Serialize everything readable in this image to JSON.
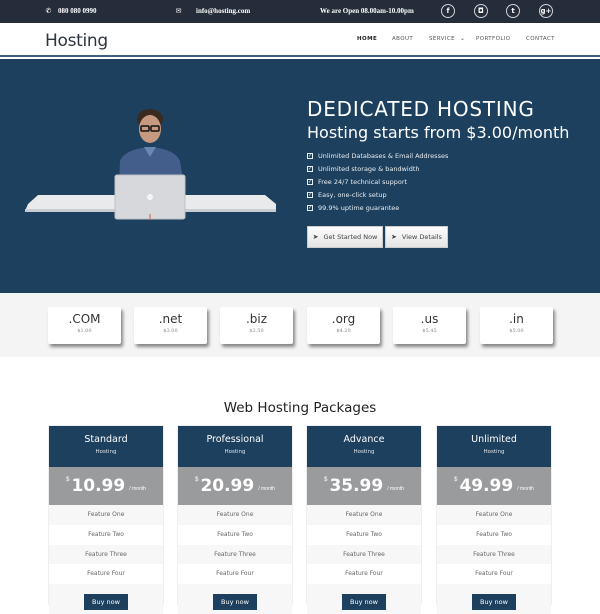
{
  "topbar": {
    "phone_icon": "phone-icon",
    "phone": "080 080 0990",
    "email_icon": "envelope-icon",
    "email": "info@hosting.com",
    "hours": "We are Open 08.00am-10.00pm",
    "social": [
      {
        "icon": "facebook-icon",
        "glyph": "f"
      },
      {
        "icon": "instagram-icon",
        "glyph": "◘"
      },
      {
        "icon": "twitter-icon",
        "glyph": "t"
      },
      {
        "icon": "google-plus-icon",
        "glyph": "g+"
      }
    ]
  },
  "nav": {
    "logo": "Hosting",
    "items": [
      "HOME",
      "ABOUT",
      "SERVICE",
      "PORTFOLIO",
      "CONTACT"
    ],
    "active": "HOME",
    "service_dropdown_icon": "chevron-down-icon"
  },
  "hero": {
    "title": "DEDICATED HOSTING",
    "subtitle": "Hosting starts from $3.00/month",
    "features": [
      "Unlimited Databases & Email Addresses",
      "Unlimited storage & bandwidth",
      "Free 24/7 technical support",
      "Easy, one-click setup",
      "99.9% uptime guarantee"
    ],
    "buttons": [
      {
        "label": "Get Started Now",
        "icon": "paper-plane-icon"
      },
      {
        "label": "View Details",
        "icon": "paper-plane-icon"
      }
    ],
    "colors": {
      "background": "#1d405e"
    }
  },
  "domains": [
    {
      "ext": ".COM",
      "price": "$1.00"
    },
    {
      "ext": ".net",
      "price": "$3.00"
    },
    {
      "ext": ".biz",
      "price": "$2.50"
    },
    {
      "ext": ".org",
      "price": "$4.20"
    },
    {
      "ext": ".us",
      "price": "$5.45"
    },
    {
      "ext": ".in",
      "price": "$5.00"
    }
  ],
  "packages": {
    "title": "Web Hosting Packages",
    "currency": "$",
    "per": "/ month",
    "buy_label": "Buy now",
    "plans": [
      {
        "name": "Standard",
        "sub": "Hosting",
        "price": "10.99",
        "features": [
          "Feature One",
          "Feature Two",
          "Feature Three",
          "Feature Four"
        ]
      },
      {
        "name": "Professional",
        "sub": "Hosting",
        "price": "20.99",
        "features": [
          "Feature One",
          "Feature Two",
          "Feature Three",
          "Feature Four"
        ]
      },
      {
        "name": "Advance",
        "sub": "Hosting",
        "price": "35.99",
        "features": [
          "Feature One",
          "Feature Two",
          "Feature Three",
          "Feature Four"
        ]
      },
      {
        "name": "Unlimited",
        "sub": "Hosting",
        "price": "49.99",
        "features": [
          "Feature One",
          "Feature Two",
          "Feature Three",
          "Feature Four"
        ]
      }
    ]
  }
}
